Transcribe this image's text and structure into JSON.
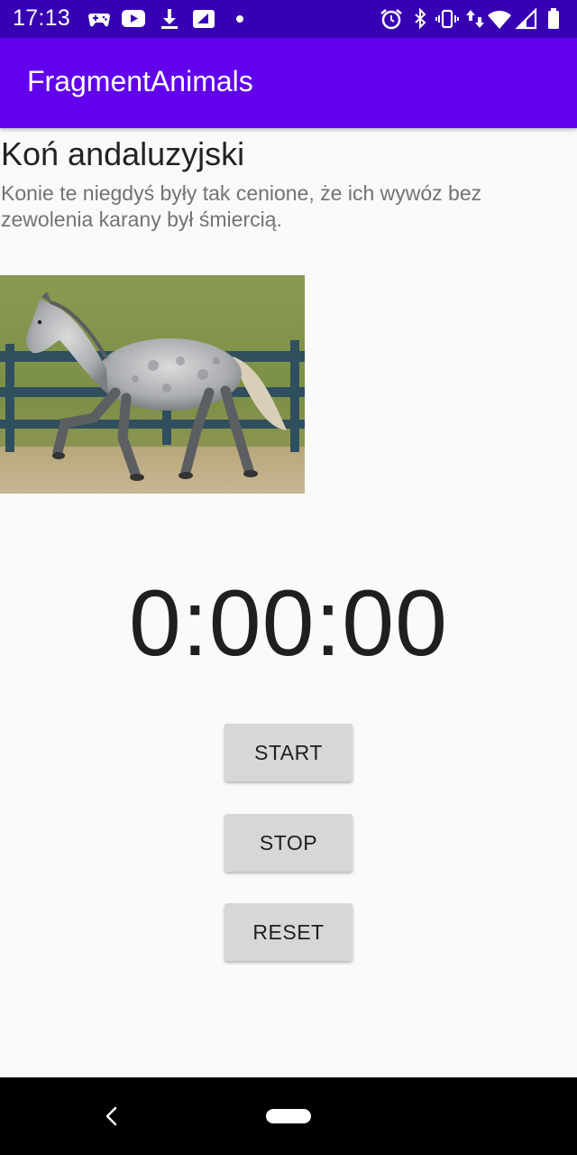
{
  "status_bar": {
    "time": "17:13",
    "left_icons": [
      "gamepad-icon",
      "youtube-icon",
      "download-icon",
      "sim-card-icon",
      "dot-icon"
    ],
    "right_icons": [
      "alarm-icon",
      "bluetooth-icon",
      "vibrate-icon",
      "data-arrows-icon",
      "wifi-icon",
      "signal-icon",
      "battery-icon"
    ],
    "background": "#3700b3"
  },
  "app_bar": {
    "title": "FragmentAnimals",
    "background": "#6200ee"
  },
  "animal": {
    "name": "Koń andaluzyjski",
    "description": "Konie te niegdyś były tak cenione, że ich wywóz bez zewolenia karany był śmiercią."
  },
  "stopwatch": {
    "time": "0:00:00"
  },
  "buttons": {
    "start": "START",
    "stop": "STOP",
    "reset": "RESET"
  }
}
